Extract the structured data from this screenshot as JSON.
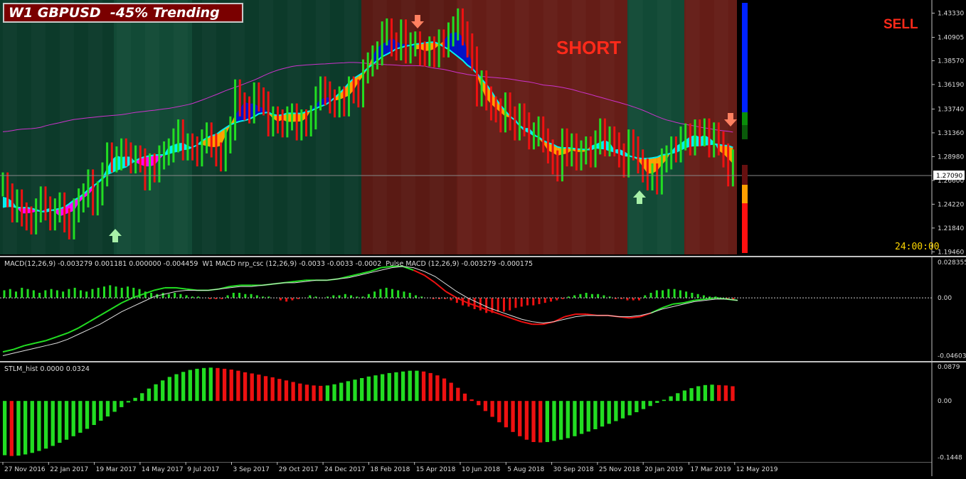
{
  "header": {
    "title": "W1 GBPUSD  -45% Trending",
    "signal_text": "SHORT",
    "action_text": "SELL",
    "timer": "24:00:00",
    "current_price": "1.27090"
  },
  "colors": {
    "bull_zone": "#0c3a2a",
    "bull_zone_alt": "#124a36",
    "bear_zone": "#5a1a14",
    "bear_zone_alt": "#651d17",
    "up_bar": "#22dd22",
    "down_bar": "#ee1111",
    "cyan": "#00f0f0",
    "magenta": "#ff00ff",
    "blue_band": "#0014c8",
    "orange_band": "#ffa000",
    "ma_line": "#cc33cc",
    "arrow_up": "#a8f0a8",
    "arrow_down": "#ff8060"
  },
  "indicators": {
    "macd_label": "MACD(12,26,9) -0.003279 0.001181 0.000000 -0.004459  W1 MACD nrp_csc (12,26,9) -0.0033 -0.0033 -0.0002  Pulse MACD (12,26,9) -0.003279 -0.000175",
    "stlm_label": "STLM_hist 0.0000 0.0324"
  },
  "chart_data": [
    {
      "type": "candlestick",
      "name": "W1 GBPUSD",
      "y_ticks": [
        1.4333,
        1.40905,
        1.3857,
        1.3619,
        1.3374,
        1.3136,
        1.2898,
        1.266,
        1.2422,
        1.2184,
        1.1946
      ],
      "y_tick_labels": [
        "1.43330",
        "1.40905",
        "1.38570",
        "1.36190",
        "1.33740",
        "1.31360",
        "1.28980",
        "1.26600",
        "1.24220",
        "1.21840",
        "1.19460"
      ],
      "ylim": [
        1.192,
        1.445
      ],
      "current_price": 1.2709,
      "x_labels": [
        "27 Nov 2016",
        "22 Jan 2017",
        "19 Mar 2017",
        "14 May 2017",
        "9 Jul 2017",
        "3 Sep 2017",
        "29 Oct 2017",
        "24 Dec 2017",
        "18 Feb 2018",
        "15 Apr 2018",
        "10 Jun 2018",
        "5 Aug 2018",
        "30 Sep 2018",
        "25 Nov 2018",
        "20 Jan 2019",
        "17 Mar 2019",
        "12 May 2019"
      ],
      "close": [
        1.262,
        1.251,
        1.236,
        1.245,
        1.232,
        1.228,
        1.224,
        1.236,
        1.248,
        1.238,
        1.228,
        1.236,
        1.242,
        1.226,
        1.219,
        1.236,
        1.246,
        1.251,
        1.265,
        1.243,
        1.253,
        1.272,
        1.292,
        1.286,
        1.288,
        1.296,
        1.292,
        1.285,
        1.289,
        1.286,
        1.268,
        1.281,
        1.276,
        1.289,
        1.293,
        1.296,
        1.306,
        1.315,
        1.298,
        1.301,
        1.298,
        1.292,
        1.305,
        1.312,
        1.301,
        1.292,
        1.287,
        1.305,
        1.318,
        1.355,
        1.342,
        1.338,
        1.335,
        1.352,
        1.347,
        1.343,
        1.322,
        1.328,
        1.325,
        1.321,
        1.328,
        1.331,
        1.318,
        1.325,
        1.322,
        1.329,
        1.348,
        1.358,
        1.353,
        1.345,
        1.341,
        1.348,
        1.342,
        1.358,
        1.355,
        1.351,
        1.375,
        1.382,
        1.389,
        1.393,
        1.413,
        1.416,
        1.402,
        1.398,
        1.415,
        1.395,
        1.402,
        1.403,
        1.393,
        1.392,
        1.398,
        1.391,
        1.405,
        1.401,
        1.412,
        1.418,
        1.426,
        1.413,
        1.401,
        1.388,
        1.352,
        1.364,
        1.348,
        1.338,
        1.336,
        1.326,
        1.342,
        1.328,
        1.318,
        1.331,
        1.322,
        1.309,
        1.312,
        1.318,
        1.306,
        1.295,
        1.284,
        1.277,
        1.306,
        1.292,
        1.301,
        1.288,
        1.294,
        1.298,
        1.291,
        1.304,
        1.316,
        1.302,
        1.308,
        1.302,
        1.291,
        1.281,
        1.305,
        1.298,
        1.285,
        1.276,
        1.268,
        1.271,
        1.264,
        1.286,
        1.289,
        1.298,
        1.296,
        1.308,
        1.311,
        1.303,
        1.315,
        1.312,
        1.316,
        1.301,
        1.312,
        1.303,
        1.291,
        1.272,
        1.285
      ],
      "annotations": [
        "SHORT",
        "SELL",
        "24:00:00"
      ]
    },
    {
      "type": "line",
      "name": "MACD",
      "y_tick_labels": [
        "0.028355",
        "0.00",
        "-0.046039"
      ],
      "ylim": [
        -0.048,
        0.03
      ],
      "series": [
        {
          "role": "histogram",
          "values": [
            0.006,
            0.007,
            0.005,
            0.008,
            0.007,
            0.006,
            0.004,
            0.006,
            0.007,
            0.006,
            0.005,
            0.007,
            0.008,
            0.006,
            0.005,
            0.007,
            0.008,
            0.009,
            0.01,
            0.009,
            0.008,
            0.009,
            0.008,
            0.007,
            0.005,
            0.004,
            0.003,
            0.004,
            0.003,
            0.004,
            0.003,
            0.002,
            0.001,
            0.001,
            0.0,
            -0.001,
            -0.001,
            -0.001,
            0.002,
            0.004,
            0.004,
            0.003,
            0.003,
            0.002,
            0.001,
            0.001,
            0.0,
            -0.002,
            -0.003,
            -0.002,
            -0.001,
            0.0,
            0.002,
            0.001,
            0.0,
            0.001,
            0.002,
            0.002,
            0.003,
            0.002,
            0.001,
            0.001,
            0.003,
            0.005,
            0.007,
            0.008,
            0.007,
            0.006,
            0.005,
            0.004,
            0.002,
            0.001,
            0.0,
            -0.001,
            -0.001,
            -0.001,
            -0.002,
            -0.004,
            -0.006,
            -0.007,
            -0.009,
            -0.01,
            -0.012,
            -0.012,
            -0.011,
            -0.011,
            -0.01,
            -0.008,
            -0.007,
            -0.006,
            -0.006,
            -0.005,
            -0.004,
            -0.003,
            -0.002,
            -0.001,
            0.001,
            0.002,
            0.003,
            0.004,
            0.003,
            0.003,
            0.002,
            0.001,
            -0.001,
            -0.001,
            -0.002,
            -0.002,
            -0.002,
            0.002,
            0.004,
            0.006,
            0.006,
            0.007,
            0.007,
            0.006,
            0.005,
            0.004,
            0.003,
            0.002,
            0.001,
            0.001,
            0.0,
            -0.001,
            -0.002
          ]
        },
        {
          "role": "macd",
          "values": [
            -0.043,
            -0.041,
            -0.038,
            -0.036,
            -0.034,
            -0.031,
            -0.028,
            -0.024,
            -0.019,
            -0.014,
            -0.009,
            -0.004,
            0.0,
            0.003,
            0.006,
            0.008,
            0.008,
            0.007,
            0.006,
            0.006,
            0.007,
            0.009,
            0.01,
            0.01,
            0.01,
            0.011,
            0.012,
            0.013,
            0.014,
            0.014,
            0.014,
            0.015,
            0.017,
            0.019,
            0.021,
            0.024,
            0.025,
            0.025,
            0.022,
            0.018,
            0.012,
            0.005,
            0.0,
            -0.004,
            -0.007,
            -0.01,
            -0.013,
            -0.016,
            -0.019,
            -0.021,
            -0.021,
            -0.019,
            -0.015,
            -0.013,
            -0.013,
            -0.014,
            -0.014,
            -0.015,
            -0.016,
            -0.015,
            -0.012,
            -0.008,
            -0.005,
            -0.004,
            -0.002,
            -0.001,
            0.0,
            -0.001,
            -0.002
          ]
        },
        {
          "role": "signal",
          "values": [
            -0.046,
            -0.044,
            -0.042,
            -0.04,
            -0.038,
            -0.036,
            -0.033,
            -0.029,
            -0.025,
            -0.021,
            -0.016,
            -0.011,
            -0.007,
            -0.003,
            0.001,
            0.003,
            0.005,
            0.006,
            0.006,
            0.006,
            0.007,
            0.008,
            0.009,
            0.009,
            0.01,
            0.011,
            0.012,
            0.012,
            0.013,
            0.014,
            0.014,
            0.015,
            0.016,
            0.018,
            0.02,
            0.022,
            0.024,
            0.025,
            0.024,
            0.021,
            0.017,
            0.011,
            0.005,
            0.0,
            -0.004,
            -0.008,
            -0.011,
            -0.014,
            -0.017,
            -0.019,
            -0.02,
            -0.019,
            -0.017,
            -0.015,
            -0.014,
            -0.014,
            -0.014,
            -0.015,
            -0.015,
            -0.014,
            -0.012,
            -0.009,
            -0.007,
            -0.005,
            -0.003,
            -0.002,
            -0.001,
            -0.001,
            -0.002
          ]
        }
      ]
    },
    {
      "type": "bar",
      "name": "STLM_hist",
      "y_tick_labels": [
        "0.0879",
        "0.00",
        "-0.1448"
      ],
      "ylim": [
        -0.15,
        0.092
      ],
      "values": [
        -0.14,
        -0.142,
        -0.141,
        -0.138,
        -0.134,
        -0.129,
        -0.123,
        -0.116,
        -0.108,
        -0.1,
        -0.091,
        -0.082,
        -0.072,
        -0.062,
        -0.051,
        -0.04,
        -0.028,
        -0.016,
        -0.004,
        0.008,
        0.02,
        0.032,
        0.043,
        0.053,
        0.062,
        0.069,
        0.075,
        0.08,
        0.083,
        0.085,
        0.086,
        0.085,
        0.083,
        0.081,
        0.078,
        0.074,
        0.071,
        0.068,
        0.064,
        0.061,
        0.057,
        0.053,
        0.049,
        0.045,
        0.042,
        0.04,
        0.039,
        0.04,
        0.043,
        0.047,
        0.051,
        0.055,
        0.059,
        0.063,
        0.066,
        0.069,
        0.072,
        0.074,
        0.076,
        0.078,
        0.078,
        0.076,
        0.072,
        0.066,
        0.058,
        0.047,
        0.034,
        0.019,
        0.004,
        -0.011,
        -0.026,
        -0.041,
        -0.055,
        -0.068,
        -0.08,
        -0.091,
        -0.1,
        -0.106,
        -0.107,
        -0.106,
        -0.103,
        -0.1,
        -0.096,
        -0.091,
        -0.085,
        -0.079,
        -0.073,
        -0.066,
        -0.059,
        -0.052,
        -0.045,
        -0.037,
        -0.029,
        -0.021,
        -0.013,
        -0.005,
        0.003,
        0.012,
        0.02,
        0.027,
        0.033,
        0.038,
        0.041,
        0.042,
        0.041,
        0.04,
        0.038
      ],
      "colors": [
        "green",
        "red"
      ]
    }
  ]
}
